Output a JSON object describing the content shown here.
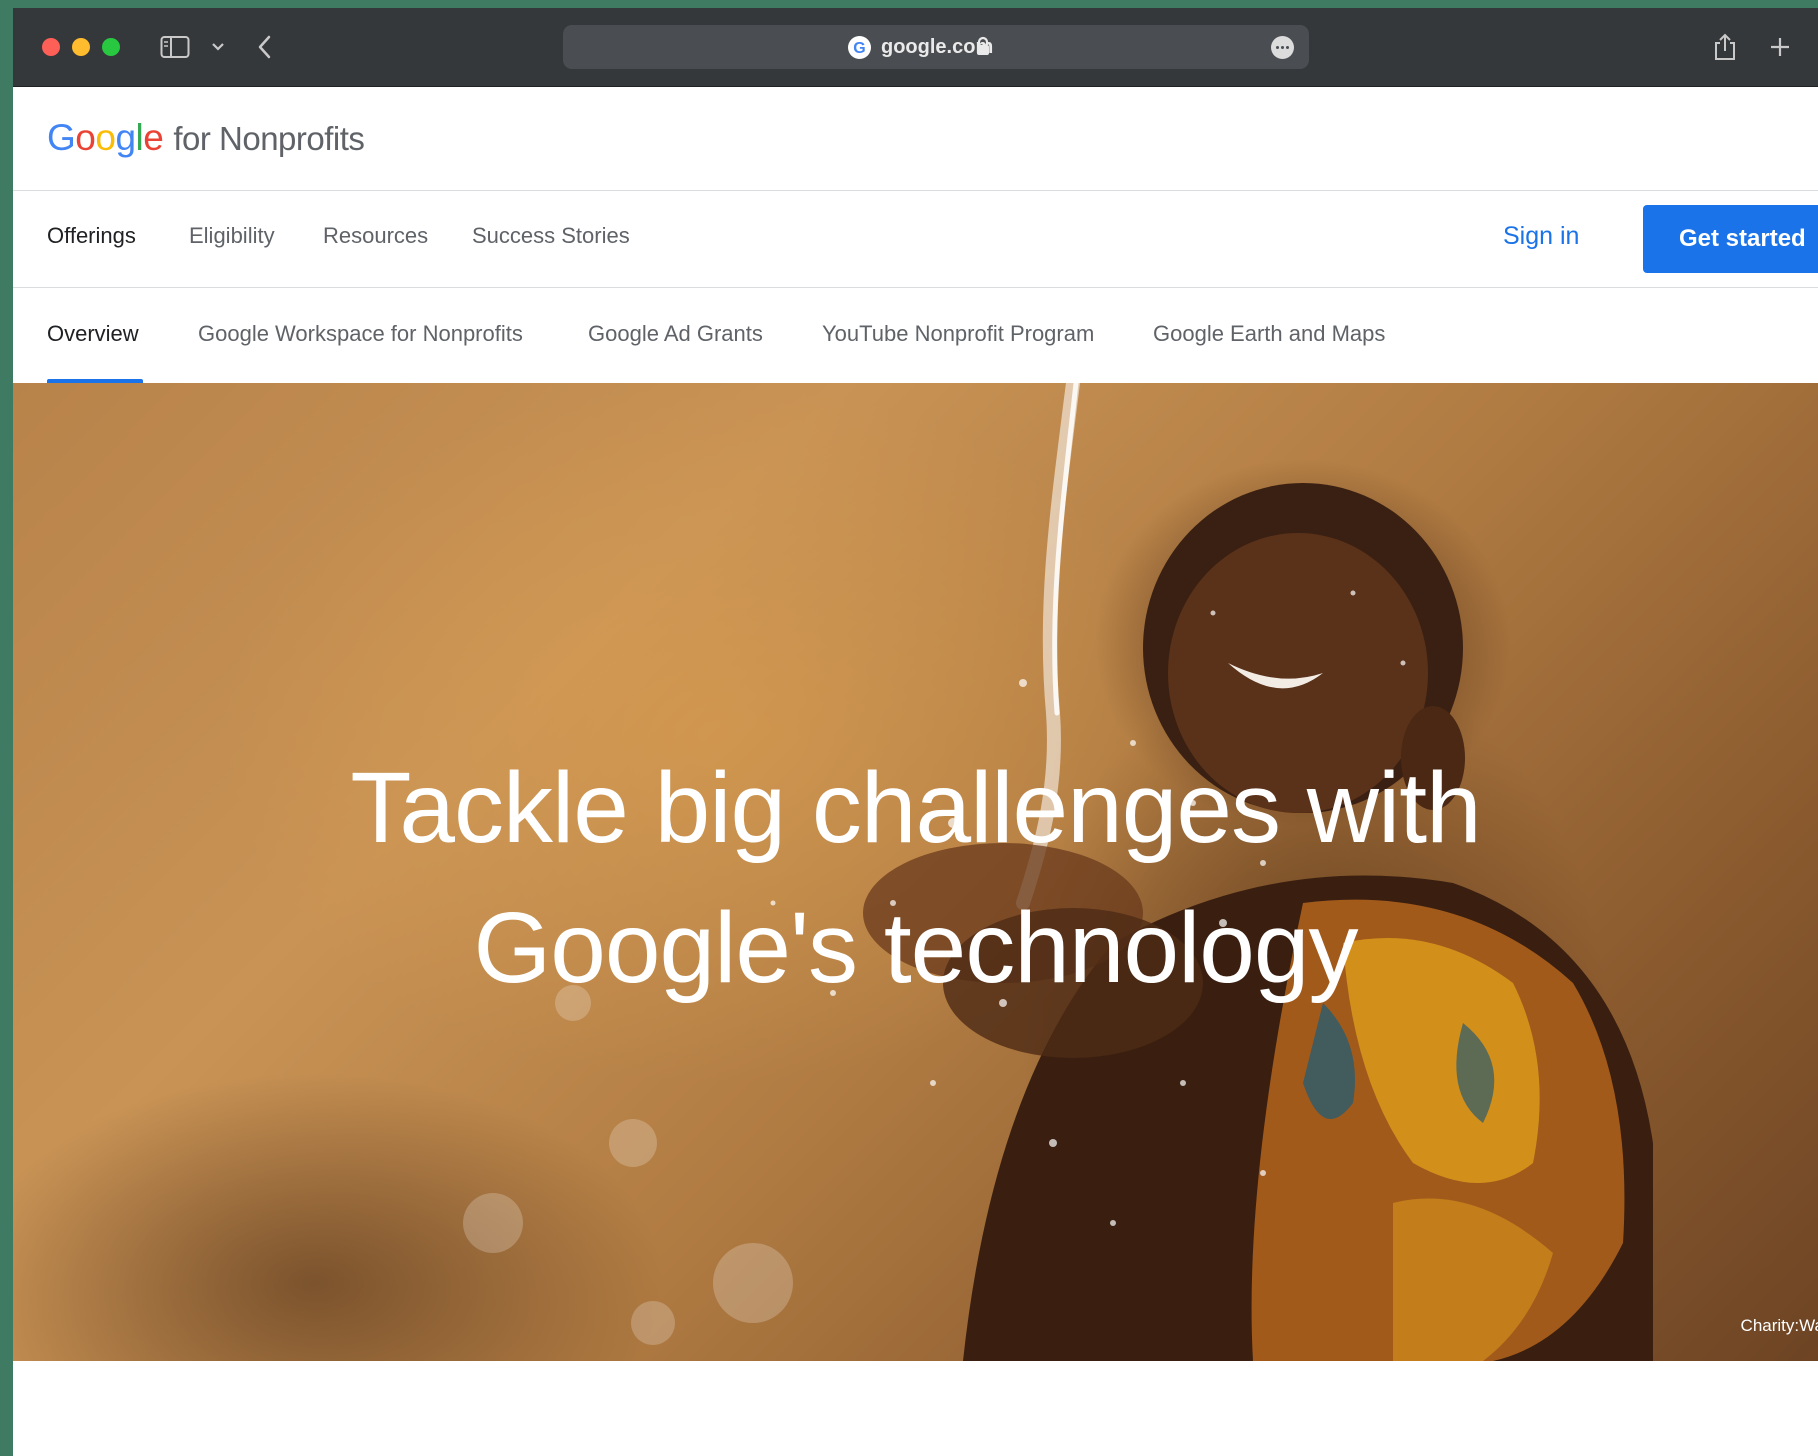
{
  "browser": {
    "url": "google.com",
    "icons": [
      "sidebar-icon",
      "chevron-down-icon",
      "back-icon",
      "google-favicon-icon",
      "lock-icon",
      "more-icon",
      "share-icon",
      "new-tab-icon"
    ]
  },
  "brand": {
    "logo_letters": [
      "G",
      "o",
      "o",
      "g",
      "l",
      "e"
    ],
    "logo_colors": [
      "#4285f4",
      "#ea4335",
      "#fbbc05",
      "#4285f4",
      "#34a853",
      "#ea4335"
    ],
    "suffix": "for Nonprofits"
  },
  "primary_nav": {
    "items": [
      "Offerings",
      "Eligibility",
      "Resources",
      "Success Stories"
    ],
    "active": "Offerings",
    "sign_in": "Sign in",
    "cta": "Get started"
  },
  "secondary_nav": {
    "items": [
      "Overview",
      "Google Workspace for Nonprofits",
      "Google Ad Grants",
      "YouTube Nonprofit Program",
      "Google Earth and Maps"
    ],
    "active": "Overview"
  },
  "hero": {
    "title_line1": "Tackle big challenges with",
    "title_line2": "Google's technology",
    "credit": "Charity:Wa"
  },
  "colors": {
    "accent": "#1a73e8",
    "toolbar": "#35383b"
  }
}
